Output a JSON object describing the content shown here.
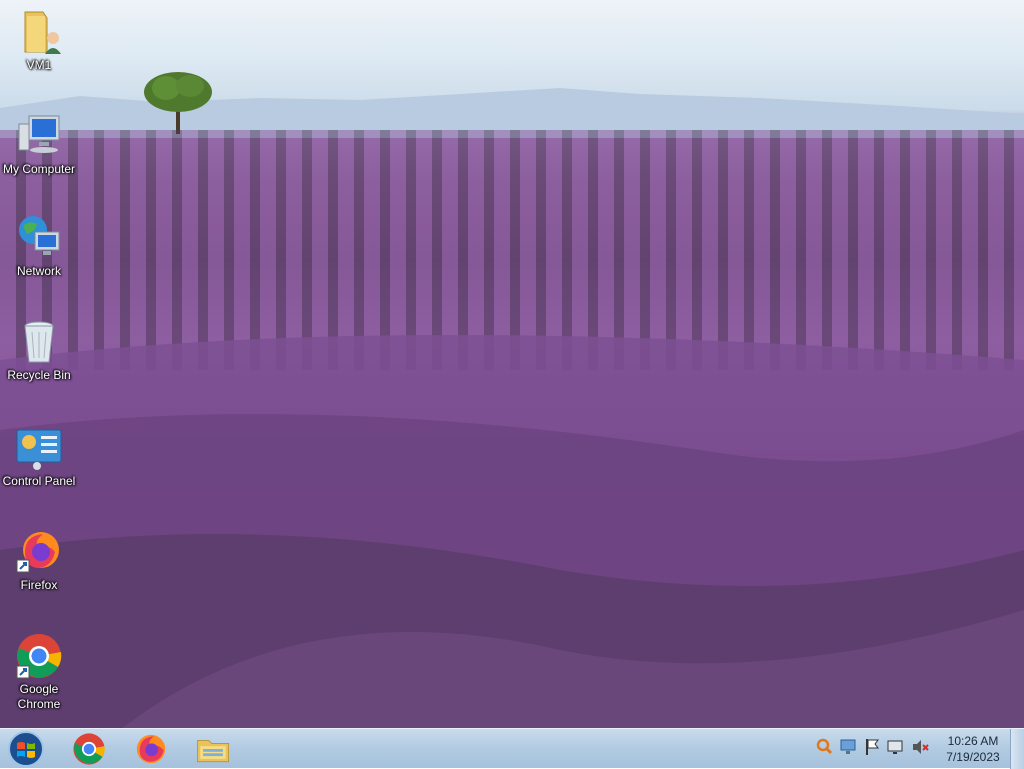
{
  "desktop": {
    "icons": [
      {
        "name": "folder-icon",
        "label": "VM1"
      },
      {
        "name": "my-computer-icon",
        "label": "My Computer"
      },
      {
        "name": "network-icon",
        "label": "Network"
      },
      {
        "name": "recycle-bin-icon",
        "label": "Recycle Bin"
      },
      {
        "name": "control-panel-icon",
        "label": "Control Panel"
      },
      {
        "name": "firefox-icon",
        "label": "Firefox"
      },
      {
        "name": "chrome-icon",
        "label": "Google Chrome"
      }
    ]
  },
  "taskbar": {
    "pinned": [
      {
        "name": "chrome-icon"
      },
      {
        "name": "firefox-icon"
      },
      {
        "name": "file-explorer-icon"
      }
    ],
    "tray": [
      "search-icon",
      "network-status-icon",
      "action-center-flag-icon",
      "display-icon",
      "volume-muted-icon"
    ],
    "clock": {
      "time": "10:26 AM",
      "date": "7/19/2023"
    }
  }
}
